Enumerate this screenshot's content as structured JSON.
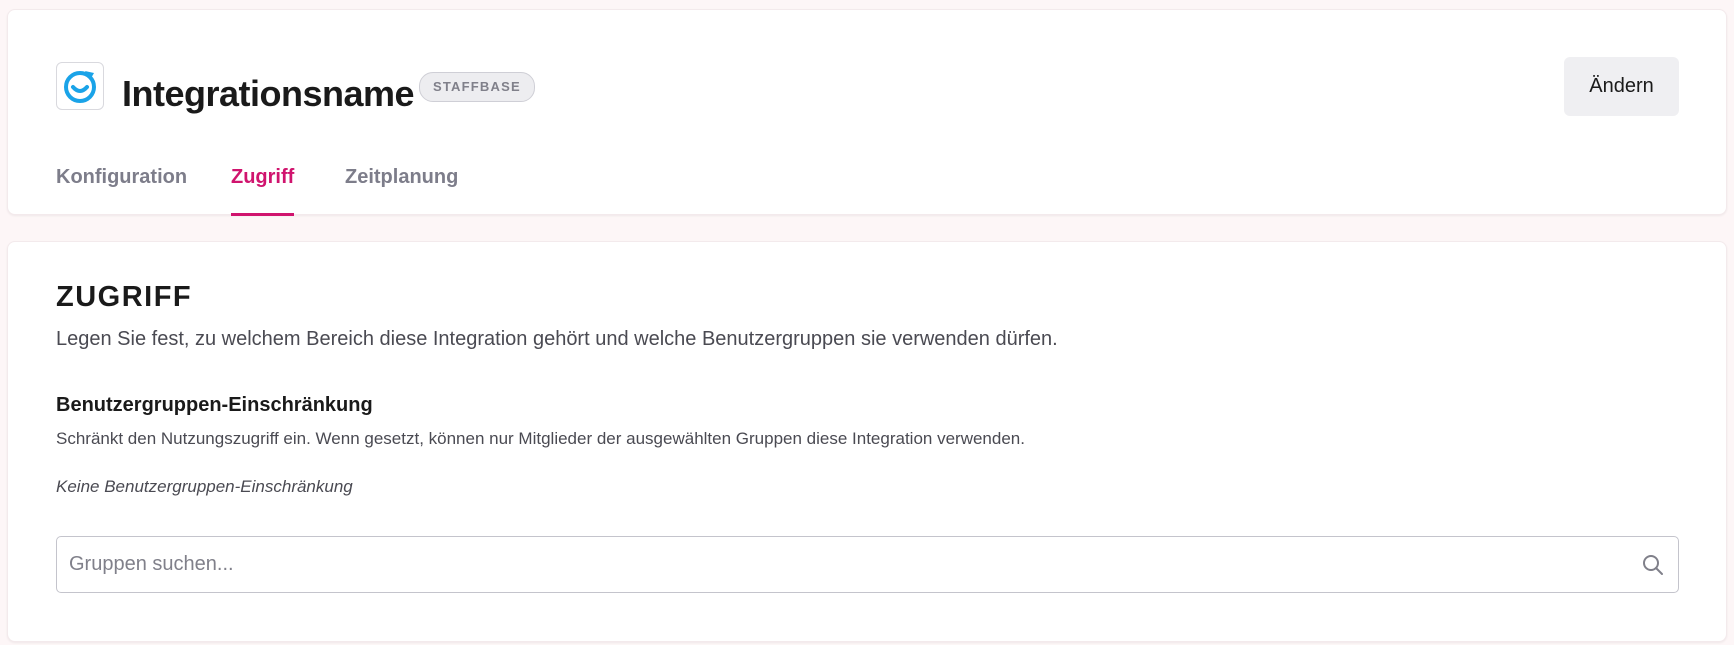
{
  "header": {
    "logo_icon": "staffbase-logo-icon",
    "title": "Integrationsname",
    "badge": "STAFFBASE",
    "edit_label": "Ändern",
    "accent_color": "#d0146e",
    "logo_color": "#1aa3e8"
  },
  "tabs": [
    {
      "label": "Konfiguration",
      "active": false
    },
    {
      "label": "Zugriff",
      "active": true
    },
    {
      "label": "Zeitplanung",
      "active": false
    }
  ],
  "access": {
    "heading": "ZUGRIFF",
    "description": "Legen Sie fest, zu welchem Bereich diese Integration gehört und welche Benutzergruppen sie verwenden dürfen.",
    "restriction": {
      "title": "Benutzergruppen-Einschränkung",
      "description": "Schränkt den Nutzungszugriff ein. Wenn gesetzt, können nur Mitglieder der ausgewählten Gruppen diese Integration verwenden.",
      "empty_note": "Keine Benutzergruppen-Einschränkung"
    },
    "search": {
      "placeholder": "Gruppen suchen...",
      "value": "",
      "icon": "search-icon"
    }
  }
}
